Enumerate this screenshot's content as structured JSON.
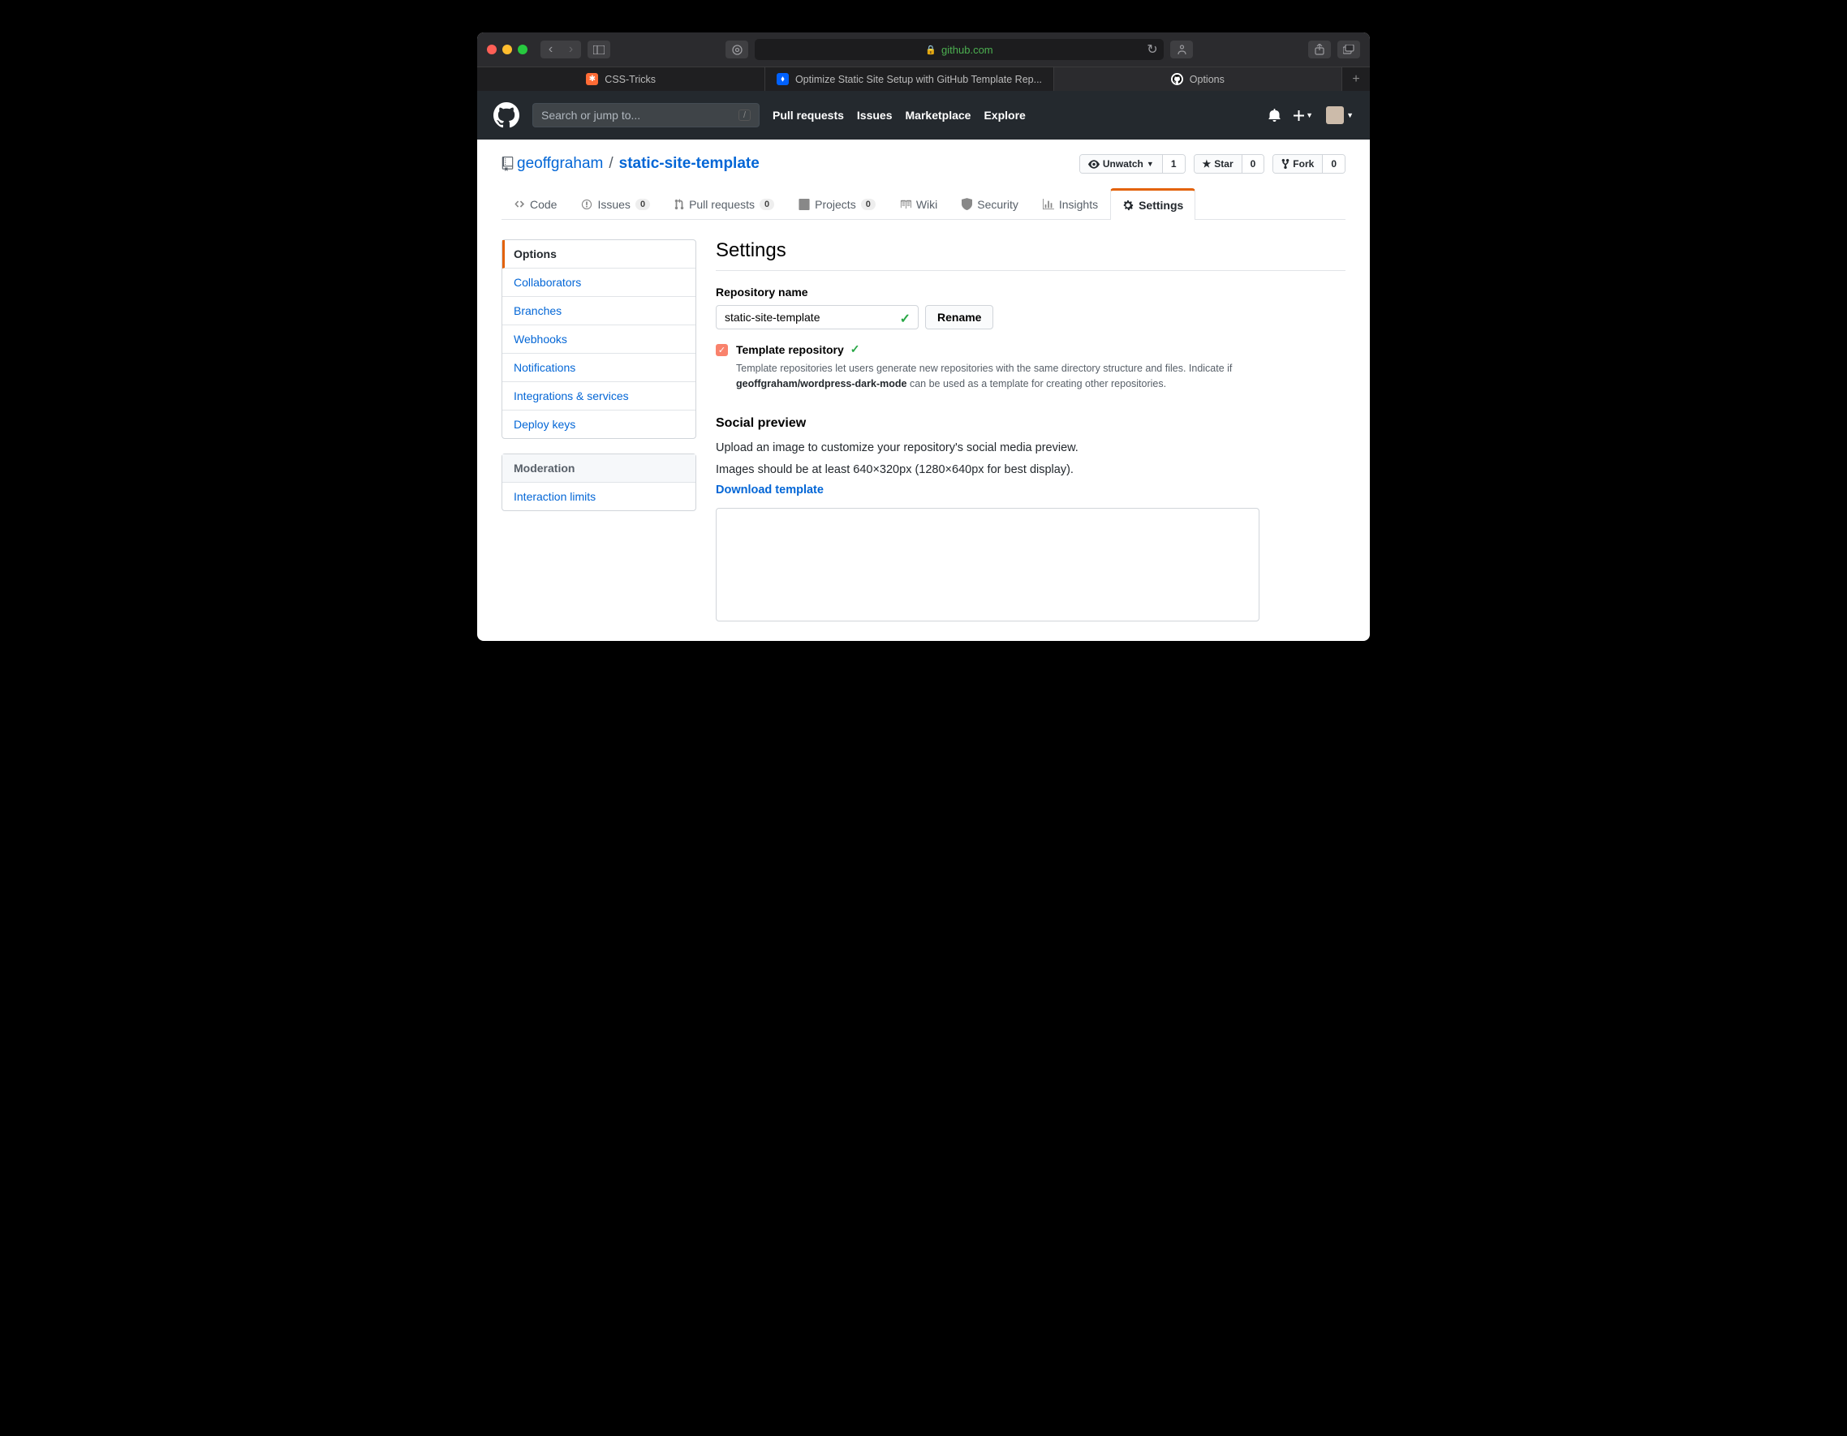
{
  "browser": {
    "url_domain": "github.com",
    "tabs": [
      {
        "label": "CSS-Tricks"
      },
      {
        "label": "Optimize Static Site Setup with GitHub Template Rep..."
      },
      {
        "label": "Options"
      }
    ]
  },
  "gh_nav": {
    "search_placeholder": "Search or jump to...",
    "links": [
      "Pull requests",
      "Issues",
      "Marketplace",
      "Explore"
    ]
  },
  "repo": {
    "owner": "geoffgraham",
    "name": "static-site-template",
    "sep": "/",
    "watch": {
      "label": "Unwatch",
      "count": "1"
    },
    "star": {
      "label": "Star",
      "count": "0"
    },
    "fork": {
      "label": "Fork",
      "count": "0"
    }
  },
  "tabs": {
    "code": "Code",
    "issues": "Issues",
    "issues_c": "0",
    "pulls": "Pull requests",
    "pulls_c": "0",
    "projects": "Projects",
    "projects_c": "0",
    "wiki": "Wiki",
    "security": "Security",
    "insights": "Insights",
    "settings": "Settings"
  },
  "sidebar": {
    "items": [
      "Options",
      "Collaborators",
      "Branches",
      "Webhooks",
      "Notifications",
      "Integrations & services",
      "Deploy keys"
    ],
    "mod_head": "Moderation",
    "mod_items": [
      "Interaction limits"
    ]
  },
  "page": {
    "title": "Settings",
    "repo_name_label": "Repository name",
    "repo_name_value": "static-site-template",
    "rename_btn": "Rename",
    "template_label": "Template repository",
    "template_help_a": "Template repositories let users generate new repositories with the same directory structure and files. Indicate if ",
    "template_help_b": "geoffgraham/wordpress-dark-mode",
    "template_help_c": " can be used as a template for creating other repositories.",
    "social_h": "Social preview",
    "social_p1": "Upload an image to customize your repository's social media preview.",
    "social_p2": "Images should be at least 640×320px (1280×640px for best display).",
    "download_link": "Download template"
  }
}
